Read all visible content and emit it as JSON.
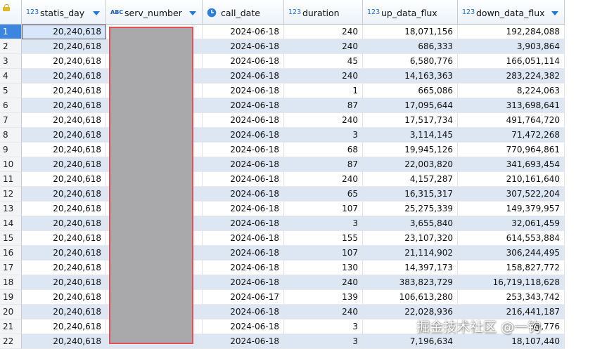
{
  "columns": [
    {
      "key": "statis_day",
      "type_icon": "123",
      "label": "statis_day"
    },
    {
      "key": "serv_number",
      "type_icon": "ABC",
      "label": "serv_number"
    },
    {
      "key": "call_date",
      "type_icon": "clock",
      "label": "call_date"
    },
    {
      "key": "duration",
      "type_icon": "123",
      "label": "duration"
    },
    {
      "key": "up_data_flux",
      "type_icon": "123",
      "label": "up_data_flux"
    },
    {
      "key": "down_data_flux",
      "type_icon": "123",
      "label": "down_data_flux"
    }
  ],
  "rows": [
    {
      "n": "1",
      "statis_day": "20,240,618",
      "call_date": "2024-06-18",
      "duration": "240",
      "up": "18,071,156",
      "down": "192,284,088"
    },
    {
      "n": "2",
      "statis_day": "20,240,618",
      "call_date": "2024-06-18",
      "duration": "240",
      "up": "686,333",
      "down": "3,903,864"
    },
    {
      "n": "3",
      "statis_day": "20,240,618",
      "call_date": "2024-06-18",
      "duration": "45",
      "up": "6,580,776",
      "down": "166,051,114"
    },
    {
      "n": "4",
      "statis_day": "20,240,618",
      "call_date": "2024-06-18",
      "duration": "240",
      "up": "14,163,363",
      "down": "283,224,382"
    },
    {
      "n": "5",
      "statis_day": "20,240,618",
      "call_date": "2024-06-18",
      "duration": "1",
      "up": "665,086",
      "down": "8,224,063"
    },
    {
      "n": "6",
      "statis_day": "20,240,618",
      "call_date": "2024-06-18",
      "duration": "87",
      "up": "17,095,644",
      "down": "313,698,641"
    },
    {
      "n": "7",
      "statis_day": "20,240,618",
      "call_date": "2024-06-18",
      "duration": "240",
      "up": "17,517,734",
      "down": "491,764,720"
    },
    {
      "n": "8",
      "statis_day": "20,240,618",
      "call_date": "2024-06-18",
      "duration": "3",
      "up": "3,114,145",
      "down": "71,472,268"
    },
    {
      "n": "9",
      "statis_day": "20,240,618",
      "call_date": "2024-06-18",
      "duration": "68",
      "up": "19,945,126",
      "down": "770,964,861"
    },
    {
      "n": "10",
      "statis_day": "20,240,618",
      "call_date": "2024-06-18",
      "duration": "87",
      "up": "22,003,820",
      "down": "341,693,454"
    },
    {
      "n": "11",
      "statis_day": "20,240,618",
      "call_date": "2024-06-18",
      "duration": "240",
      "up": "4,157,287",
      "down": "210,161,640"
    },
    {
      "n": "12",
      "statis_day": "20,240,618",
      "call_date": "2024-06-18",
      "duration": "65",
      "up": "16,315,317",
      "down": "307,522,204"
    },
    {
      "n": "13",
      "statis_day": "20,240,618",
      "call_date": "2024-06-18",
      "duration": "107",
      "up": "25,275,339",
      "down": "149,379,957"
    },
    {
      "n": "14",
      "statis_day": "20,240,618",
      "call_date": "2024-06-18",
      "duration": "3",
      "up": "3,655,840",
      "down": "32,061,459"
    },
    {
      "n": "15",
      "statis_day": "20,240,618",
      "call_date": "2024-06-18",
      "duration": "155",
      "up": "23,107,320",
      "down": "614,553,884"
    },
    {
      "n": "16",
      "statis_day": "20,240,618",
      "call_date": "2024-06-18",
      "duration": "107",
      "up": "21,114,902",
      "down": "306,244,495"
    },
    {
      "n": "17",
      "statis_day": "20,240,618",
      "call_date": "2024-06-18",
      "duration": "130",
      "up": "14,397,173",
      "down": "158,827,772"
    },
    {
      "n": "18",
      "statis_day": "20,240,618",
      "call_date": "2024-06-18",
      "duration": "240",
      "up": "383,823,729",
      "down": "16,719,118,628"
    },
    {
      "n": "19",
      "statis_day": "20,240,618",
      "call_date": "2024-06-17",
      "duration": "139",
      "up": "106,613,280",
      "down": "253,343,742"
    },
    {
      "n": "20",
      "statis_day": "20,240,618",
      "call_date": "2024-06-18",
      "duration": "240",
      "up": "22,028,936",
      "down": "216,441,187"
    },
    {
      "n": "21",
      "statis_day": "20,240,618",
      "call_date": "2024-06-18",
      "duration": "3",
      "up": "",
      "down": "@,776"
    },
    {
      "n": "22",
      "statis_day": "20,240,618",
      "call_date": "2024-06-18",
      "duration": "3",
      "up": "7,196,634",
      "down": "18,107,440"
    }
  ],
  "selected_row": "1",
  "watermark": "掘金技术社区 @一钩",
  "colors": {
    "header_icon": "#1f78d1",
    "alt_row": "#dde6f3",
    "redaction": "#a9a9ab",
    "redaction_border": "#e0525b"
  }
}
